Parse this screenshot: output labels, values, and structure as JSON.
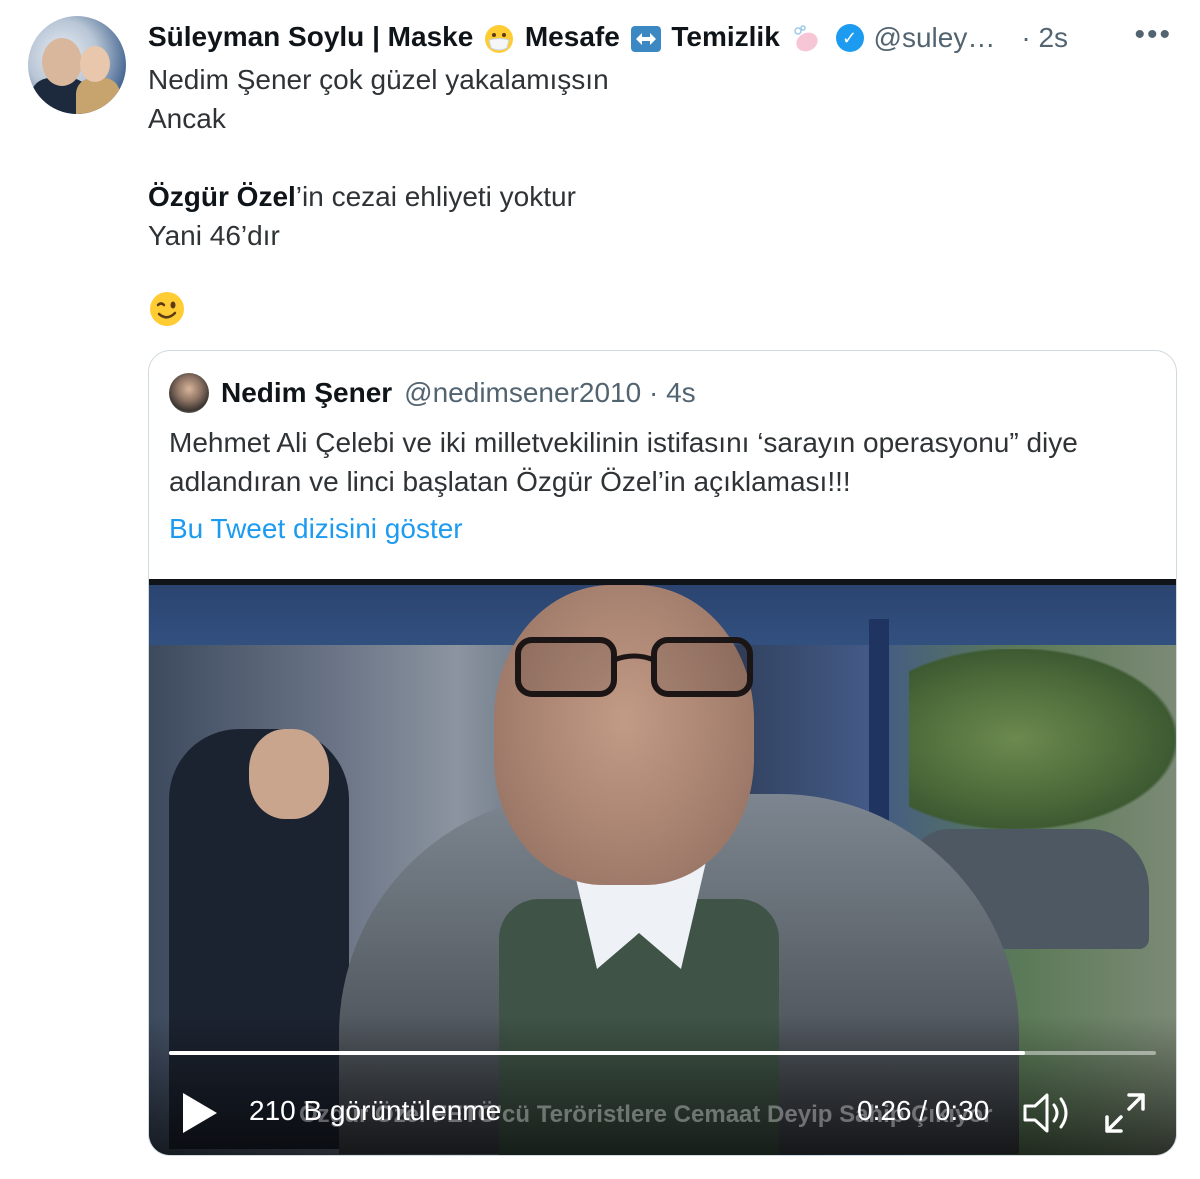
{
  "author": {
    "name_parts": [
      "Süleyman Soylu | Maske",
      " Mesafe",
      " Temizlik"
    ],
    "handle": "@suley…",
    "time": "· 2s",
    "verified": true,
    "more_label": "•••"
  },
  "tweet": {
    "line1": "Nedim Şener çok güzel yakalamışsın",
    "line2": "Ancak",
    "line3_bold": "Özgür Özel",
    "line3_rest": "’in cezai ehliyeti yoktur",
    "line4": "Yani 46’dır"
  },
  "quoted": {
    "name": "Nedim Şener",
    "handle": "@nedimsener2010 · 4s",
    "text": "Mehmet Ali Çelebi ve iki milletvekilinin istifasını ‘sarayın operasyonu” diye adlandıran ve linci başlatan Özgür Özel’in açıklaması!!!",
    "thread_link": "Bu Tweet dizisini göster"
  },
  "video": {
    "views": "210 B görüntülenme",
    "caption": "Özgür Özel FETÖ'cü Teröristlere Cemaat Deyip Sahip Çıkıyor",
    "time": "0:26 / 0:30",
    "progress": 0.867
  },
  "icons": {
    "mask_emoji": "😷",
    "arrows_emoji": "↔",
    "soap_emoji": "🧼",
    "wink_emoji": "wink-emoji",
    "verified_icon": "verified-badge-icon",
    "play_icon": "play-icon",
    "volume_icon": "volume-icon",
    "fullscreen_icon": "fullscreen-icon"
  },
  "colors": {
    "link": "#1d9bf0",
    "secondary_text": "#536471",
    "verified": "#1d9bf0"
  }
}
